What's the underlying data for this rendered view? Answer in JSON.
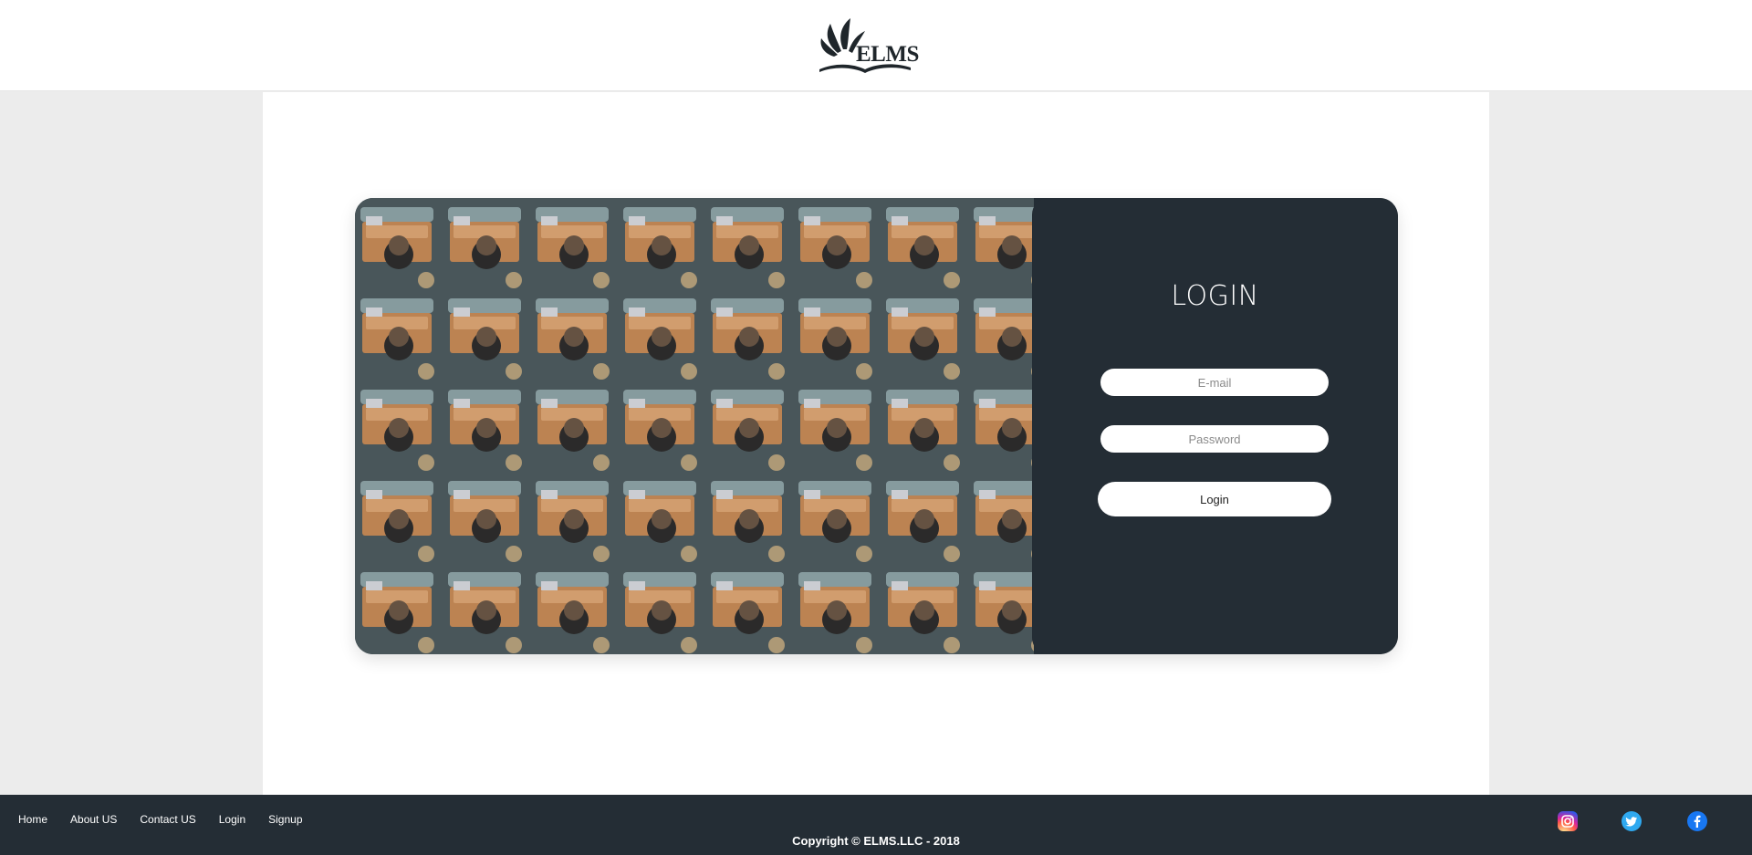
{
  "brand": {
    "logo_text": "ELMS"
  },
  "login": {
    "title": "LOGIN",
    "email_placeholder": "E-mail",
    "password_placeholder": "Password",
    "submit_label": "Login"
  },
  "footer": {
    "nav": [
      "Home",
      "About US",
      "Contact US",
      "Login",
      "Signup"
    ],
    "copyright": "Copyright © ELMS.LLC - 2018",
    "social": [
      "instagram-icon",
      "twitter-icon",
      "facebook-icon"
    ]
  },
  "colors": {
    "panel_dark": "#242d35",
    "page_bg": "#ececec",
    "accent_white": "#ffffff"
  }
}
